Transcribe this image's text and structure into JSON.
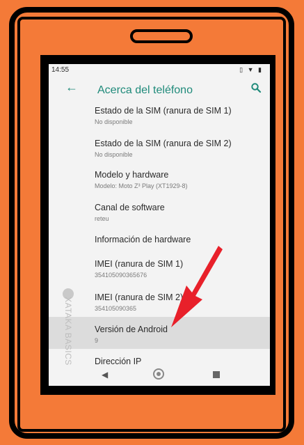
{
  "status": {
    "time": "14:55",
    "icons": "▯ ▼ ▮"
  },
  "header": {
    "back_icon": "←",
    "title": "Acerca del teléfono"
  },
  "items": [
    {
      "title": "Estado de la SIM (ranura de SIM 1)",
      "subtitle": "No disponible"
    },
    {
      "title": "Estado de la SIM (ranura de SIM 2)",
      "subtitle": "No disponible"
    },
    {
      "title": "Modelo y hardware",
      "subtitle": "Modelo: Moto Z³ Play (XT1929-8)"
    },
    {
      "title": "Canal de software",
      "subtitle": "reteu"
    },
    {
      "title": "Información de hardware",
      "subtitle": ""
    },
    {
      "title": "IMEI (ranura de SIM 1)",
      "subtitle": "354105090365676"
    },
    {
      "title": "IMEI (ranura de SIM 2)",
      "subtitle": "354105090365"
    },
    {
      "title": "Versión de Android",
      "subtitle": "9"
    },
    {
      "title": "Dirección IP",
      "subtitle": ""
    }
  ],
  "watermark": {
    "text": "XATAKA BASICS"
  },
  "colors": {
    "frame": "#f47a38",
    "accent": "#1f8a7a",
    "arrow": "#e8202a"
  }
}
